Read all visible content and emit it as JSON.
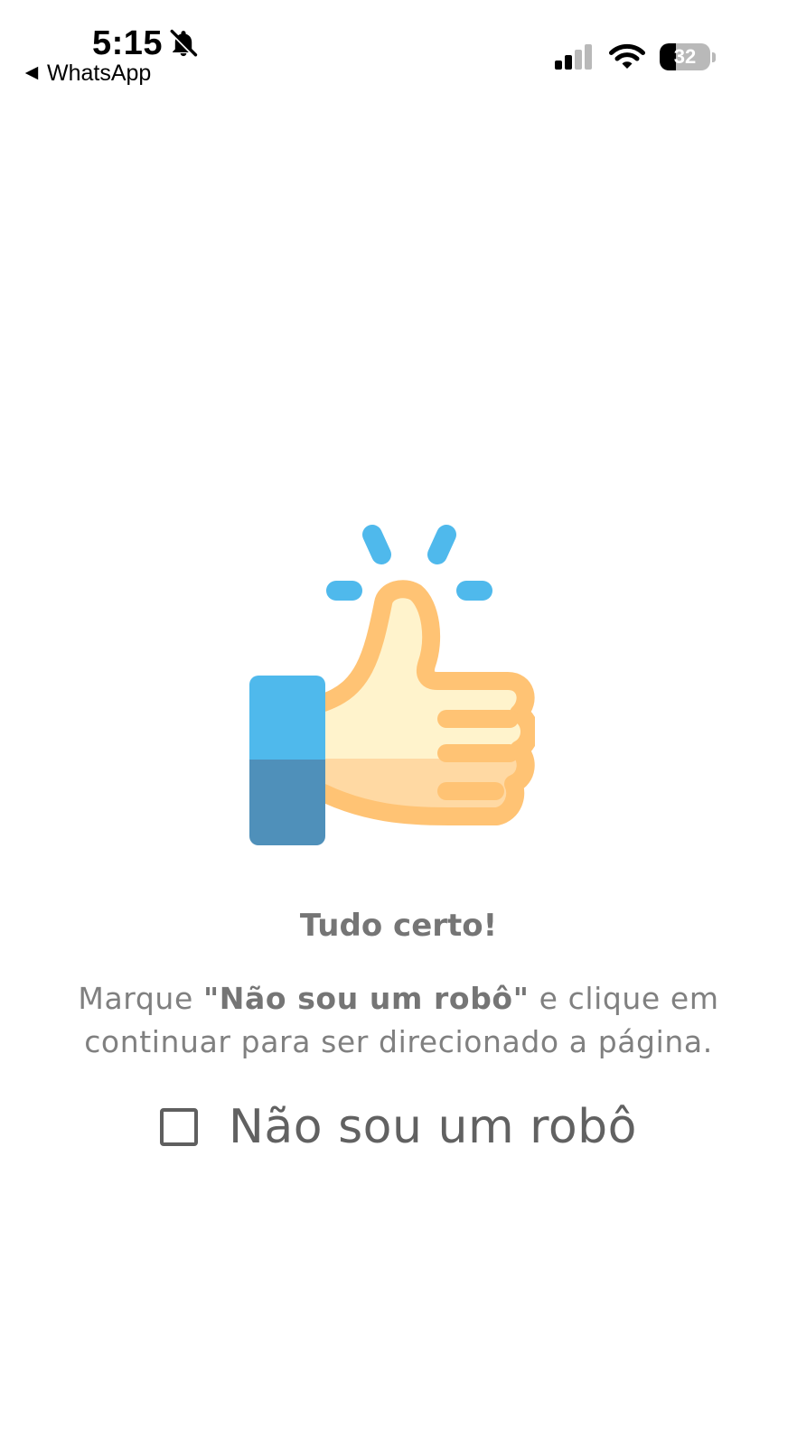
{
  "status_bar": {
    "time": "5:15",
    "back_label": "WhatsApp",
    "battery_level": "32",
    "battery_fraction": 0.32,
    "icons": [
      "bell-slash-icon",
      "back-arrow-icon",
      "cellular-signal-icon",
      "wifi-icon",
      "battery-icon"
    ]
  },
  "hero": {
    "icon": "thumbs-up-icon",
    "colors": {
      "sleeve_top": "#4fb9ec",
      "sleeve_bottom": "#4f90ba",
      "hand_light": "#fff3cc",
      "hand_shadow": "#ffd9a3",
      "hand_outline": "#ffc374",
      "sparkle": "#4fb9ec"
    }
  },
  "content": {
    "headline": "Tudo certo!",
    "instruction_before": "Marque ",
    "instruction_bold": "\"Não sou um robô\"",
    "instruction_after": " e clique em continuar para ser direcionado a página.",
    "checkbox_label": "Não sou um robô",
    "checkbox_checked": false
  },
  "colors": {
    "text_primary": "#757575",
    "text_secondary": "#808080",
    "checkbox_border": "#5f5f5f"
  }
}
